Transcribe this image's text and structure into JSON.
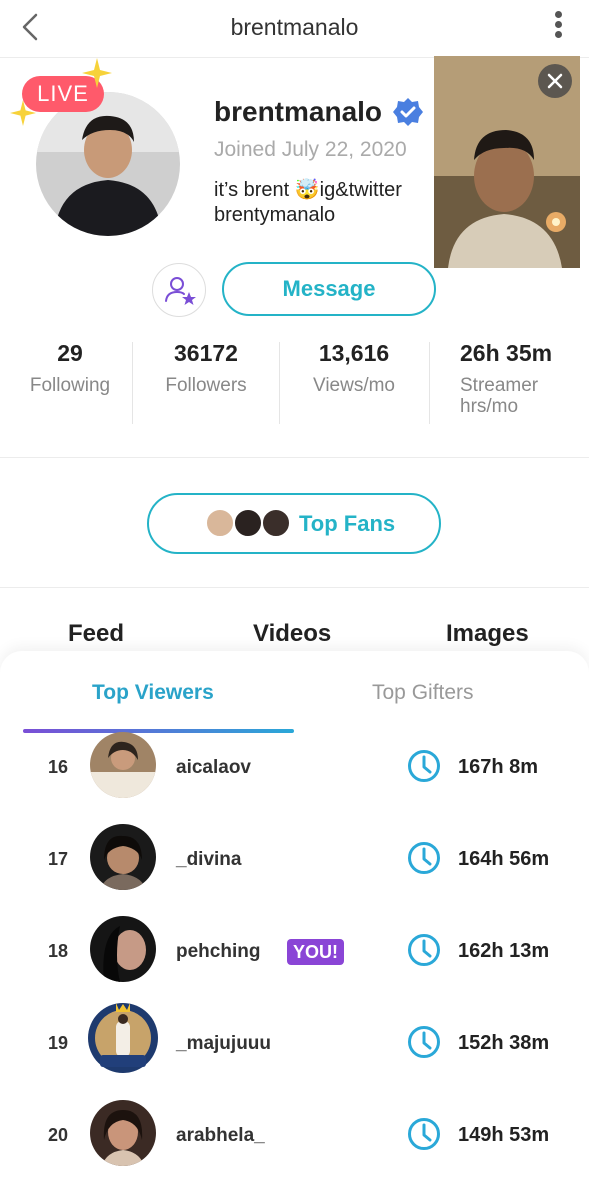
{
  "header": {
    "title": "brentmanalo",
    "back_icon": "chevron-left-icon",
    "more_icon": "more-vertical-icon"
  },
  "profile": {
    "live_label": "LIVE",
    "name": "brentmanalo",
    "verified_icon": "verified-badge-icon",
    "joined": "Joined July 22, 2020",
    "bio": "it’s brent 🤯ig&twitter\nbrentymanalo"
  },
  "actions": {
    "follow_icon": "user-star-icon",
    "message_label": "Message"
  },
  "stats": [
    {
      "value": "29",
      "label": "Following"
    },
    {
      "value": "36172",
      "label": "Followers"
    },
    {
      "value": "13,616",
      "label": "Views/mo"
    },
    {
      "value": "26h 35m",
      "label": "Streamer\nhrs/mo"
    }
  ],
  "top_fans": {
    "label": "Top Fans"
  },
  "content_tabs": [
    "Feed",
    "Videos",
    "Images"
  ],
  "viewer_tabs": {
    "active": "Top Viewers",
    "inactive": "Top Gifters"
  },
  "viewers": [
    {
      "rank": "16",
      "username": "aicalaov",
      "duration": "167h 8m"
    },
    {
      "rank": "17",
      "username": "_divina",
      "duration": "164h 56m"
    },
    {
      "rank": "18",
      "username": "pehching",
      "badge": "YOU!",
      "duration": "162h 13m"
    },
    {
      "rank": "19",
      "username": "_majujuuu",
      "duration": "152h 38m"
    },
    {
      "rank": "20",
      "username": "arabhela_",
      "duration": "149h 53m"
    }
  ],
  "colors": {
    "accent": "#24b3c7",
    "live": "#ff5a6b",
    "you_badge": "#8a45d6",
    "indicator_start": "#7a4ed6",
    "indicator_end": "#2aa8d8"
  }
}
